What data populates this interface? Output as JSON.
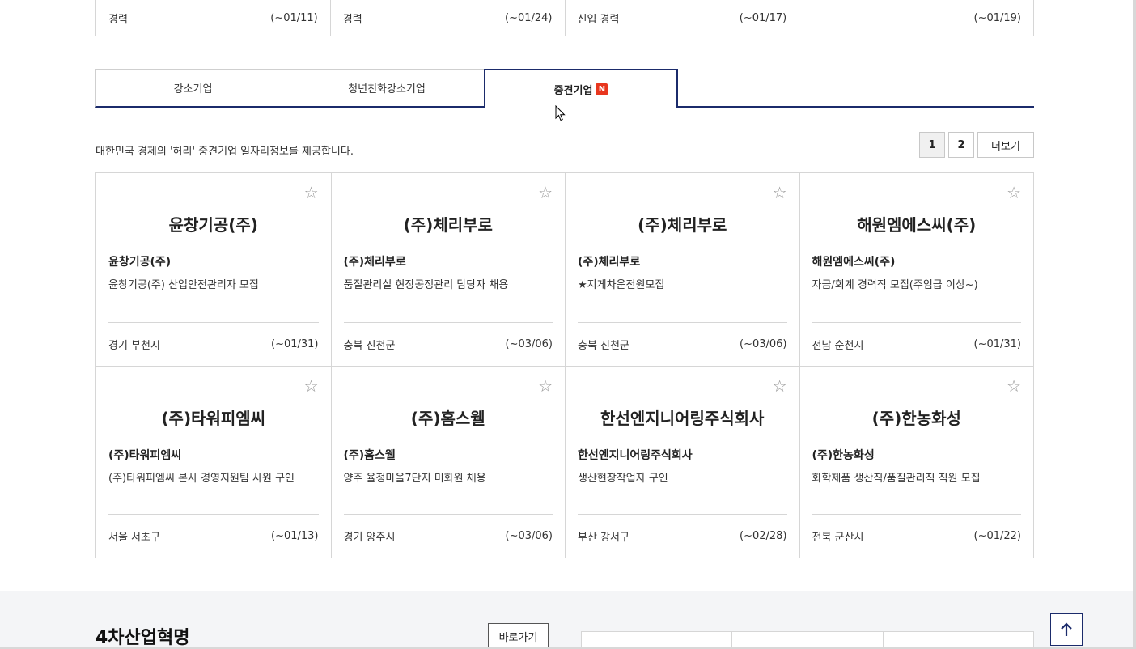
{
  "top_row": [
    {
      "type": "경력",
      "deadline": "(~01/11)"
    },
    {
      "type": "경력",
      "deadline": "(~01/24)"
    },
    {
      "type": "신입 경력",
      "deadline": "(~01/17)"
    },
    {
      "type": "",
      "deadline": "(~01/19)"
    }
  ],
  "tabs": [
    {
      "label": "강소기업"
    },
    {
      "label": "청년친화강소기업"
    },
    {
      "label": "중견기업",
      "badge": "N",
      "active": true
    }
  ],
  "description": "대한민국 경제의 '허리' 중견기업 일자리정보를 제공합니다.",
  "pager": {
    "pages": [
      "1",
      "2"
    ],
    "current": "1",
    "more_label": "더보기"
  },
  "cards": [
    {
      "title": "윤창기공(주)",
      "company": "윤창기공(주)",
      "job": "윤창기공(주) 산업안전관리자 모집",
      "location": "경기 부천시",
      "deadline": "(~01/31)"
    },
    {
      "title": "(주)체리부로",
      "company": "(주)체리부로",
      "job": "품질관리실 현장공정관리 담당자 채용",
      "location": "충북 진천군",
      "deadline": "(~03/06)"
    },
    {
      "title": "(주)체리부로",
      "company": "(주)체리부로",
      "job": "★지게차운전원모집",
      "location": "충북 진천군",
      "deadline": "(~03/06)"
    },
    {
      "title": "해원엠에스씨(주)",
      "company": "해원엠에스씨(주)",
      "job": "자금/회계 경력직 모집(주임급 이상~)",
      "location": "전남 순천시",
      "deadline": "(~01/31)"
    },
    {
      "title": "(주)타워피엠씨",
      "company": "(주)타워피엠씨",
      "job": "(주)타워피엠씨 본사 경영지원팀 사원 구인",
      "location": "서울 서초구",
      "deadline": "(~01/13)"
    },
    {
      "title": "(주)홈스웰",
      "company": "(주)홈스웰",
      "job": "양주 율정마을7단지 미화원 채용",
      "location": "경기 양주시",
      "deadline": "(~03/06)"
    },
    {
      "title": "한선엔지니어링주식회사",
      "company": "한선엔지니어링주식회사",
      "job": "생산현장작업자 구인",
      "location": "부산 강서구",
      "deadline": "(~02/28)"
    },
    {
      "title": "(주)한농화성",
      "company": "(주)한농화성",
      "job": "화학제품 생산직/품질관리직 직원 모집",
      "location": "전북 군산시",
      "deadline": "(~01/22)"
    }
  ],
  "star_glyph": "☆",
  "bottom": {
    "section_title": "4차산업혁명",
    "shortcut_label": "바로가기"
  },
  "colors": {
    "accent": "#1b2b6b",
    "badge": "#e8361e"
  }
}
